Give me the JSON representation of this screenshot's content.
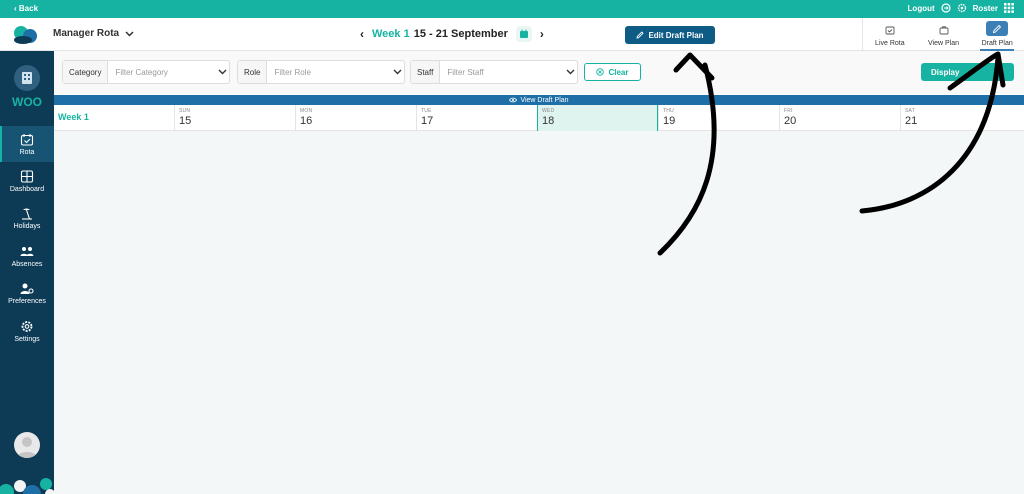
{
  "topbar": {
    "back_label": "‹ Back",
    "logout_label": "Logout",
    "roster_label": "Roster"
  },
  "header": {
    "app_title": "Manager Rota",
    "week_label": "Week 1",
    "week_range": "15 - 21 September",
    "edit_draft_label": "Edit Draft Plan",
    "view_tabs": [
      {
        "label": "Live Rota",
        "icon": "calendar-check-icon"
      },
      {
        "label": "View Plan",
        "icon": "briefcase-icon"
      },
      {
        "label": "Draft Plan",
        "icon": "pencil-icon",
        "active": true
      }
    ]
  },
  "sidebar": {
    "org_name": "WOO",
    "items": [
      {
        "label": "Rota",
        "icon": "calendar-icon",
        "active": true
      },
      {
        "label": "Dashboard",
        "icon": "grid-icon"
      },
      {
        "label": "Holidays",
        "icon": "beach-icon"
      },
      {
        "label": "Absences",
        "icon": "people-icon"
      },
      {
        "label": "Preferences",
        "icon": "user-settings-icon"
      },
      {
        "label": "Settings",
        "icon": "gear-icon"
      }
    ]
  },
  "filters": {
    "category": {
      "label": "Category",
      "placeholder": "Filter Category"
    },
    "role": {
      "label": "Role",
      "placeholder": "Filter Role"
    },
    "staff": {
      "label": "Staff",
      "placeholder": "Filter Staff"
    },
    "clear_label": "Clear",
    "display_label": "Display"
  },
  "draft_strip_label": "View Draft Plan",
  "calendar": {
    "week_label": "Week 1",
    "days": [
      {
        "abbr": "SUN",
        "num": "15"
      },
      {
        "abbr": "MON",
        "num": "16"
      },
      {
        "abbr": "TUE",
        "num": "17"
      },
      {
        "abbr": "WED",
        "num": "18",
        "today": true
      },
      {
        "abbr": "THU",
        "num": "19"
      },
      {
        "abbr": "FRI",
        "num": "20"
      },
      {
        "abbr": "SAT",
        "num": "21"
      }
    ]
  },
  "colors": {
    "teal": "#17b3a2",
    "navy": "#0d3b56",
    "blue": "#0e5b86"
  }
}
